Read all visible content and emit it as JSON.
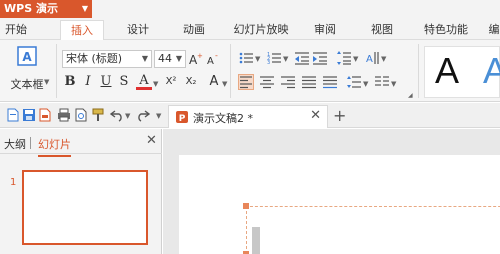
{
  "app": {
    "title": "WPS 演示"
  },
  "menu": {
    "tabs": [
      {
        "label": "开始"
      },
      {
        "label": "插入"
      },
      {
        "label": "设计"
      },
      {
        "label": "动画"
      },
      {
        "label": "幻灯片放映"
      },
      {
        "label": "审阅"
      },
      {
        "label": "视图"
      },
      {
        "label": "特色功能"
      },
      {
        "label": "编"
      }
    ],
    "active_tab": "插入"
  },
  "ribbon": {
    "textbox_label": "文本框",
    "font_name": "宋体 (标题)",
    "font_size": "44",
    "format_buttons": [
      "B",
      "I",
      "U",
      "S",
      "A",
      "X²",
      "X₂",
      "A"
    ],
    "style_samples": [
      "A",
      "A"
    ]
  },
  "document_tab": {
    "title": "演示文稿2 *"
  },
  "left_pane": {
    "tabs": [
      {
        "label": "大纲"
      },
      {
        "label": "幻灯片"
      }
    ],
    "active_tab": "幻灯片",
    "slide_number": "1"
  },
  "colors": {
    "accent": "#d9572c",
    "ribbon_bg": "#f5f5f5",
    "selection_border": "#e8a882"
  }
}
